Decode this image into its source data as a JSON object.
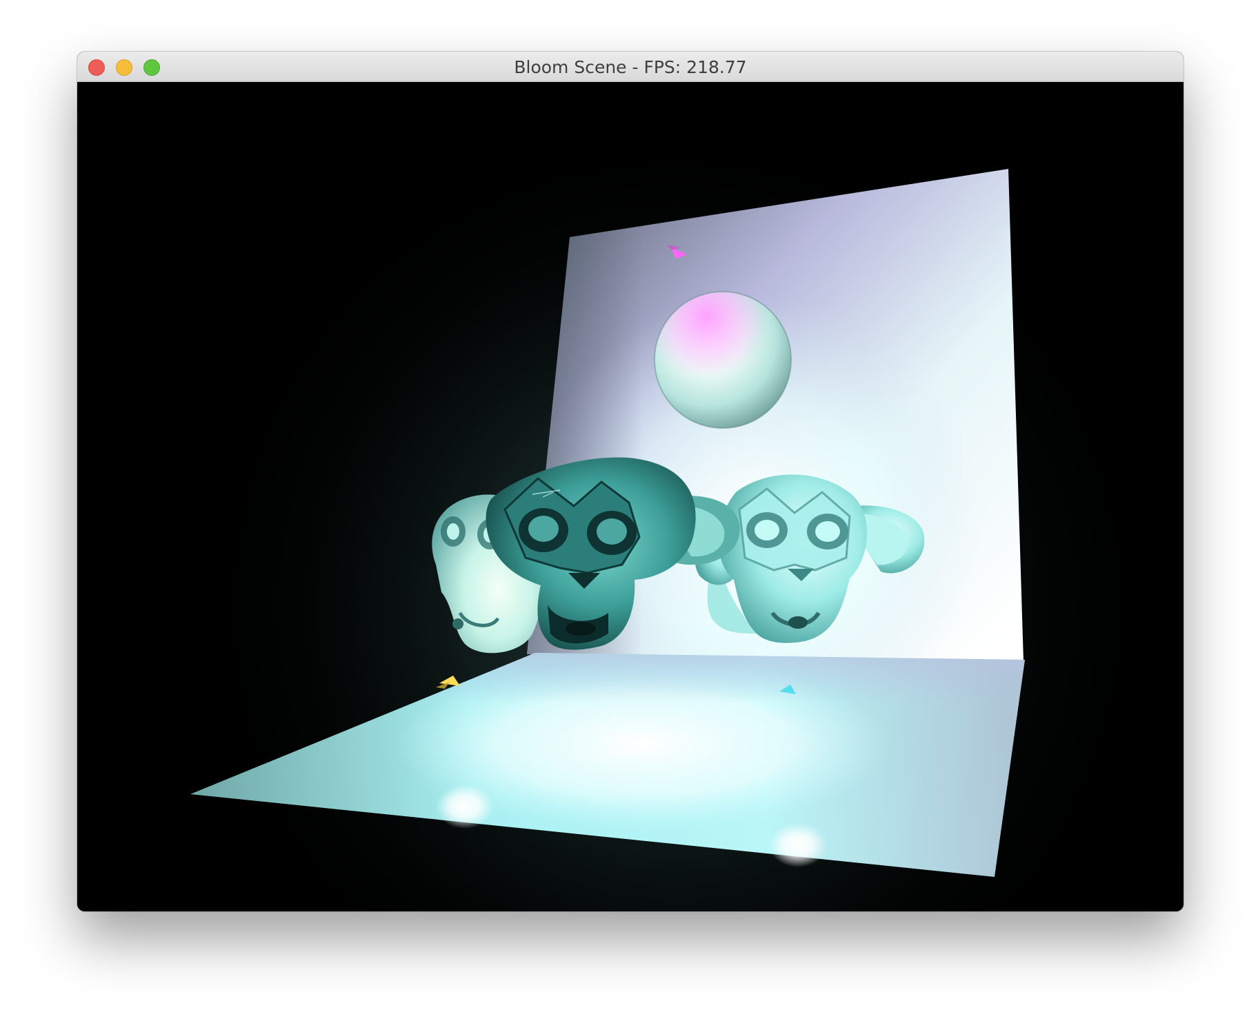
{
  "window": {
    "title": "Bloom Scene - FPS: 218.77",
    "controls": {
      "close": "close-button",
      "minimize": "minimize-button",
      "zoom": "zoom-button"
    }
  },
  "scene": {
    "background_color": "#000000",
    "objects": [
      "back-wall",
      "floor-plane",
      "sphere",
      "monkey-head-left",
      "monkey-head-center",
      "monkey-head-right"
    ],
    "light_colors": [
      "#ff66ff",
      "#ffdd55",
      "#55ddee",
      "#ffffff"
    ]
  }
}
